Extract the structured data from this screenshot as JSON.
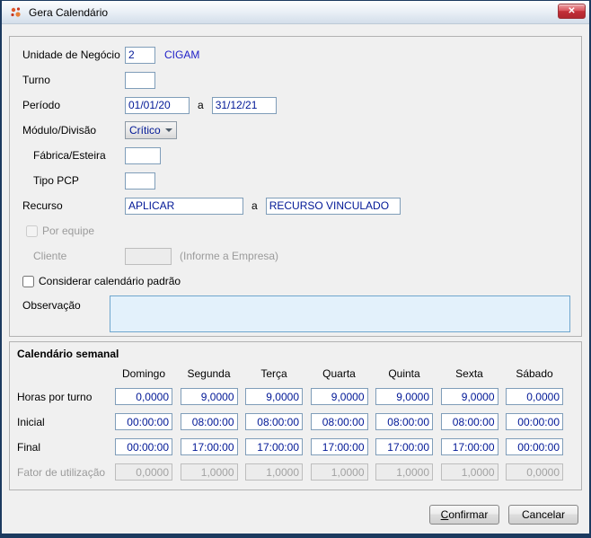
{
  "window": {
    "title": "Gera Calendário",
    "close_glyph": "✕"
  },
  "form": {
    "unidade_label": "Unidade de Negócio",
    "unidade_value": "2",
    "unidade_desc": "CIGAM",
    "turno_label": "Turno",
    "turno_value": "",
    "periodo_label": "Período",
    "periodo_from": "01/01/20",
    "periodo_sep": "a",
    "periodo_to": "31/12/21",
    "modulo_label": "Módulo/Divisão",
    "modulo_value": "Crítico",
    "fabrica_label": "Fábrica/Esteira",
    "fabrica_value": "",
    "tipo_label": "Tipo PCP",
    "tipo_value": "",
    "recurso_label": "Recurso",
    "recurso_from": "APLICAR",
    "recurso_sep": "a",
    "recurso_to": "RECURSO VINCULADO",
    "por_equipe_label": "Por equipe",
    "cliente_label": "Cliente",
    "cliente_value": "",
    "cliente_hint": "(Informe a Empresa)",
    "considerar_label": "Considerar calendário padrão",
    "observacao_label": "Observação",
    "observacao_value": ""
  },
  "weekly": {
    "title": "Calendário semanal",
    "days": [
      "Domingo",
      "Segunda",
      "Terça",
      "Quarta",
      "Quinta",
      "Sexta",
      "Sábado"
    ],
    "rows": [
      {
        "label": "Horas por turno",
        "values": [
          "0,0000",
          "9,0000",
          "9,0000",
          "9,0000",
          "9,0000",
          "9,0000",
          "0,0000"
        ]
      },
      {
        "label": "Inicial",
        "values": [
          "00:00:00",
          "08:00:00",
          "08:00:00",
          "08:00:00",
          "08:00:00",
          "08:00:00",
          "00:00:00"
        ]
      },
      {
        "label": "Final",
        "values": [
          "00:00:00",
          "17:00:00",
          "17:00:00",
          "17:00:00",
          "17:00:00",
          "17:00:00",
          "00:00:00"
        ]
      },
      {
        "label": "Fator de utilização",
        "values": [
          "0,0000",
          "1,0000",
          "1,0000",
          "1,0000",
          "1,0000",
          "1,0000",
          "0,0000"
        ]
      }
    ]
  },
  "buttons": {
    "confirm": "Confirmar",
    "cancel": "Cancelar"
  }
}
